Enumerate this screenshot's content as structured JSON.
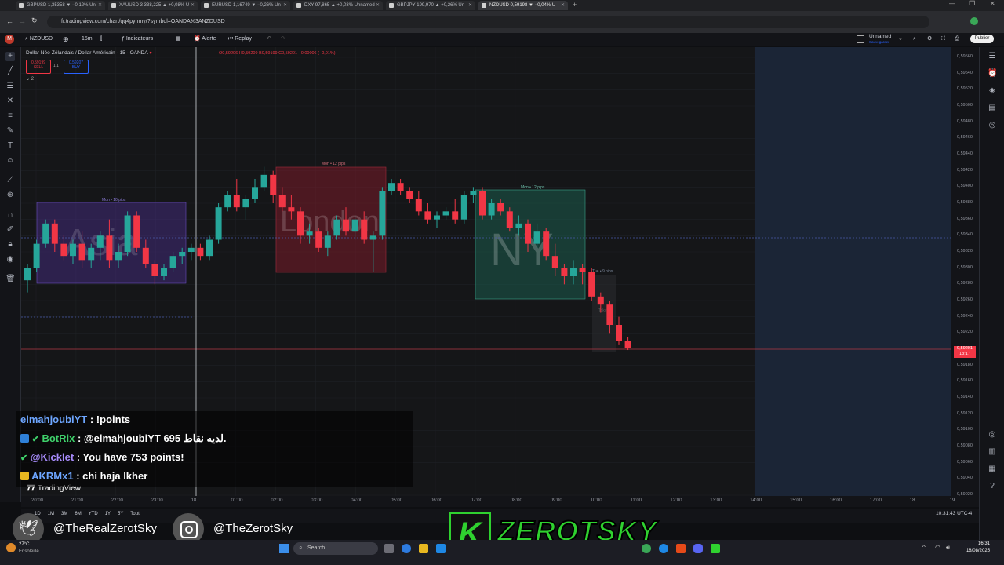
{
  "browser": {
    "tabs": [
      {
        "label": "GBPUSD 1,35358 ▼ −0,12% Un"
      },
      {
        "label": "XAUUSD 3 338,225 ▲ +0,08% U"
      },
      {
        "label": "EURUSD 1,16749 ▼ −0,26% Un"
      },
      {
        "label": "DXY 97,865 ▲ +0,03% Unnamed"
      },
      {
        "label": "GBPJPY 199,970 ▲ +0,26% Un"
      },
      {
        "label": "NZDUSD 0,59198 ▼ −0,04% U"
      }
    ],
    "url": "fr.tradingview.com/chart/qq4pynmy/?symbol=OANDA%3ANZDUSD"
  },
  "toolbar": {
    "symbol": "NZDUSD",
    "interval": "15m",
    "indicators": "Indicateurs",
    "alert": "Alerte",
    "replay": "Replay",
    "layout_name": "Unnamed",
    "layout_sub": "Sauvegarder",
    "publish": "Publier"
  },
  "legend": {
    "title": "Dollar Néo-Zélandais / Dollar Américain · 15 · OANDA",
    "ohlc": "O0,59206 H0,59209 B0,59199 C0,59201 −0,00006 (−0,01%)",
    "sell_price": "0,59199",
    "sell_label": "SELL",
    "spread": "1,1",
    "buy_price": "0,59207",
    "buy_label": "BUY",
    "collapse": "2"
  },
  "sessions": {
    "asia": {
      "label": "Asia",
      "range": "Mon • 10 pips",
      "color": "#5b3fa0"
    },
    "london": {
      "label": "London",
      "range": "Mon • 12 pips",
      "color": "#8b1d2c"
    },
    "ny": {
      "label": "NY",
      "range": "Mon • 12 pips",
      "color": "#1f6b5a"
    },
    "tokyo_next": {
      "label": "Tokyo",
      "range": "Tue • 9 pips"
    }
  },
  "price_axis": [
    "0,59560",
    "0,59540",
    "0,59520",
    "0,59500",
    "0,59480",
    "0,59460",
    "0,59440",
    "0,59420",
    "0,59400",
    "0,59380",
    "0,59360",
    "0,59340",
    "0,59320",
    "0,59300",
    "0,59280",
    "0,59260",
    "0,59240",
    "0,59220",
    "0,59200",
    "0,59180",
    "0,59160",
    "0,59140",
    "0,59120",
    "0,59100",
    "0,59080",
    "0,59060",
    "0,59040",
    "0,59020"
  ],
  "current_price": {
    "value": "0,59201",
    "countdown": "13:17"
  },
  "time_axis": [
    "20:00",
    "21:00",
    "22:00",
    "23:00",
    "18",
    "01:00",
    "02:00",
    "03:00",
    "04:00",
    "05:00",
    "06:00",
    "07:00",
    "08:00",
    "09:00",
    "10:00",
    "11:00",
    "12:00",
    "13:00",
    "14:00",
    "15:00",
    "16:00",
    "17:00",
    "18",
    "19"
  ],
  "bottom_bar": {
    "ranges": [
      "1D",
      "1M",
      "3M",
      "6M",
      "YTD",
      "1Y",
      "5Y",
      "Tout"
    ],
    "clock": "10:31:43 UTC-4",
    "tv_logo": "TradingView"
  },
  "chat": [
    {
      "user": "elmahjoubiYT",
      "color": "#6ea6ff",
      "text": ": !points",
      "badge": ""
    },
    {
      "user": "BotRix",
      "color": "#3fd16b",
      "text": ": @elmahjoubiYT 695 لديه نقاط.",
      "badge": "bot"
    },
    {
      "user": "@Kicklet",
      "color": "#a78bfa",
      "text": ": You have 753 points!",
      "badge": "check"
    },
    {
      "user": "AKRMx1",
      "color": "#6ea6ff",
      "text": ": chi haja lkher",
      "badge": "crown"
    }
  ],
  "overlay": {
    "twitter": "@TheRealZerotSky",
    "instagram": "@TheZerotSky",
    "brand_letter": "K",
    "brand_name": "ZEROTSKY"
  },
  "taskbar": {
    "weather_temp": "27°C",
    "weather_desc": "Ensoleillé",
    "search": "Search",
    "time": "16:31",
    "date": "18/08/2025"
  },
  "chart_data": {
    "type": "candlestick",
    "symbol": "NZDUSD",
    "interval": "15",
    "ylim": [
      0.5902,
      0.5956
    ],
    "candles_ohlc": [
      [
        0.59285,
        0.59305,
        0.5927,
        0.593
      ],
      [
        0.593,
        0.59335,
        0.59295,
        0.5933
      ],
      [
        0.5933,
        0.5936,
        0.59325,
        0.59355
      ],
      [
        0.59355,
        0.5936,
        0.5932,
        0.5933
      ],
      [
        0.5933,
        0.5934,
        0.5931,
        0.59315
      ],
      [
        0.59315,
        0.59335,
        0.59305,
        0.5933
      ],
      [
        0.5933,
        0.59345,
        0.593,
        0.5931
      ],
      [
        0.5931,
        0.5933,
        0.593,
        0.59325
      ],
      [
        0.59325,
        0.59345,
        0.5931,
        0.5934
      ],
      [
        0.5934,
        0.5936,
        0.593,
        0.5931
      ],
      [
        0.5931,
        0.5933,
        0.593,
        0.5932
      ],
      [
        0.5932,
        0.5937,
        0.59315,
        0.59365
      ],
      [
        0.59365,
        0.5937,
        0.5932,
        0.59325
      ],
      [
        0.59325,
        0.59335,
        0.593,
        0.59305
      ],
      [
        0.59305,
        0.5931,
        0.5928,
        0.5929
      ],
      [
        0.5929,
        0.59305,
        0.59285,
        0.593
      ],
      [
        0.593,
        0.5932,
        0.59295,
        0.59315
      ],
      [
        0.59315,
        0.59325,
        0.59305,
        0.5932
      ],
      [
        0.5932,
        0.5933,
        0.5931,
        0.59325
      ],
      [
        0.59325,
        0.5933,
        0.5931,
        0.59315
      ],
      [
        0.59315,
        0.5934,
        0.5931,
        0.59335
      ],
      [
        0.59335,
        0.5938,
        0.5933,
        0.59375
      ],
      [
        0.59375,
        0.59395,
        0.5937,
        0.5939
      ],
      [
        0.5939,
        0.5941,
        0.5937,
        0.59375
      ],
      [
        0.59375,
        0.5939,
        0.5936,
        0.59385
      ],
      [
        0.59385,
        0.5941,
        0.5938,
        0.594
      ],
      [
        0.594,
        0.59425,
        0.59395,
        0.59415
      ],
      [
        0.59415,
        0.5942,
        0.5938,
        0.5939
      ],
      [
        0.5939,
        0.594,
        0.5937,
        0.59375
      ],
      [
        0.59375,
        0.5939,
        0.5936,
        0.5937
      ],
      [
        0.5937,
        0.59375,
        0.5933,
        0.5934
      ],
      [
        0.5934,
        0.59355,
        0.5933,
        0.59345
      ],
      [
        0.59345,
        0.5935,
        0.5932,
        0.59325
      ],
      [
        0.59325,
        0.59345,
        0.59315,
        0.5934
      ],
      [
        0.5934,
        0.59365,
        0.59335,
        0.5936
      ],
      [
        0.5936,
        0.59375,
        0.5934,
        0.59345
      ],
      [
        0.59345,
        0.59365,
        0.59335,
        0.5936
      ],
      [
        0.5936,
        0.5937,
        0.5933,
        0.59335
      ],
      [
        0.59335,
        0.59345,
        0.59295,
        0.5934
      ],
      [
        0.5934,
        0.594,
        0.59335,
        0.59395
      ],
      [
        0.59395,
        0.5941,
        0.5939,
        0.59405
      ],
      [
        0.59405,
        0.5941,
        0.5939,
        0.59395
      ],
      [
        0.59395,
        0.594,
        0.5938,
        0.59385
      ],
      [
        0.59385,
        0.59395,
        0.59365,
        0.5937
      ],
      [
        0.5937,
        0.5938,
        0.59355,
        0.5936
      ],
      [
        0.5936,
        0.5937,
        0.5935,
        0.59365
      ],
      [
        0.59365,
        0.59375,
        0.5936,
        0.5937
      ],
      [
        0.5937,
        0.59385,
        0.59355,
        0.5936
      ],
      [
        0.5936,
        0.59395,
        0.59355,
        0.5939
      ],
      [
        0.5939,
        0.594,
        0.5938,
        0.59395
      ],
      [
        0.59395,
        0.594,
        0.5936,
        0.59365
      ],
      [
        0.59365,
        0.59385,
        0.5936,
        0.5938
      ],
      [
        0.5938,
        0.59385,
        0.59365,
        0.5937
      ],
      [
        0.5937,
        0.59375,
        0.59345,
        0.5935
      ],
      [
        0.5935,
        0.59365,
        0.5934,
        0.59355
      ],
      [
        0.59355,
        0.5936,
        0.5932,
        0.5933
      ],
      [
        0.5933,
        0.59355,
        0.59325,
        0.59345
      ],
      [
        0.59345,
        0.5935,
        0.5931,
        0.59315
      ],
      [
        0.59315,
        0.5933,
        0.5929,
        0.593
      ],
      [
        0.593,
        0.59305,
        0.5928,
        0.5929
      ],
      [
        0.5929,
        0.5931,
        0.5928,
        0.593
      ],
      [
        0.593,
        0.59305,
        0.5928,
        0.59295
      ],
      [
        0.59295,
        0.593,
        0.5926,
        0.59265
      ],
      [
        0.59265,
        0.5927,
        0.59245,
        0.59255
      ],
      [
        0.59255,
        0.5926,
        0.5922,
        0.5923
      ],
      [
        0.5923,
        0.5924,
        0.59205,
        0.5921
      ],
      [
        0.5921,
        0.59215,
        0.59199,
        0.59201
      ]
    ]
  }
}
